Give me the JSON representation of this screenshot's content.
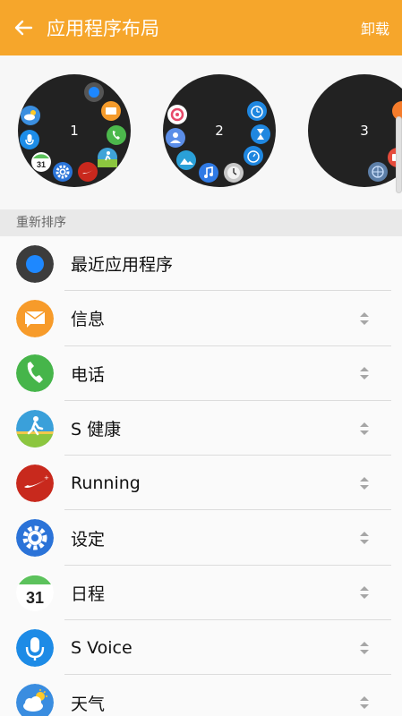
{
  "appbar": {
    "title": "应用程序布局",
    "action": "卸载"
  },
  "pages": [
    {
      "label": "1"
    },
    {
      "label": "2"
    },
    {
      "label": "3"
    }
  ],
  "section": {
    "title": "重新排序"
  },
  "apps": [
    {
      "label": "最近应用程序",
      "icon": "recent-apps-icon"
    },
    {
      "label": "信息",
      "icon": "messages-icon"
    },
    {
      "label": "电话",
      "icon": "phone-icon"
    },
    {
      "label": "S 健康",
      "icon": "s-health-icon"
    },
    {
      "label": "Running",
      "icon": "nike-running-icon"
    },
    {
      "label": "设定",
      "icon": "settings-gear-icon"
    },
    {
      "label": "日程",
      "icon": "calendar-icon",
      "badge": "31"
    },
    {
      "label": "S Voice",
      "icon": "microphone-icon"
    },
    {
      "label": "天气",
      "icon": "weather-icon"
    }
  ]
}
